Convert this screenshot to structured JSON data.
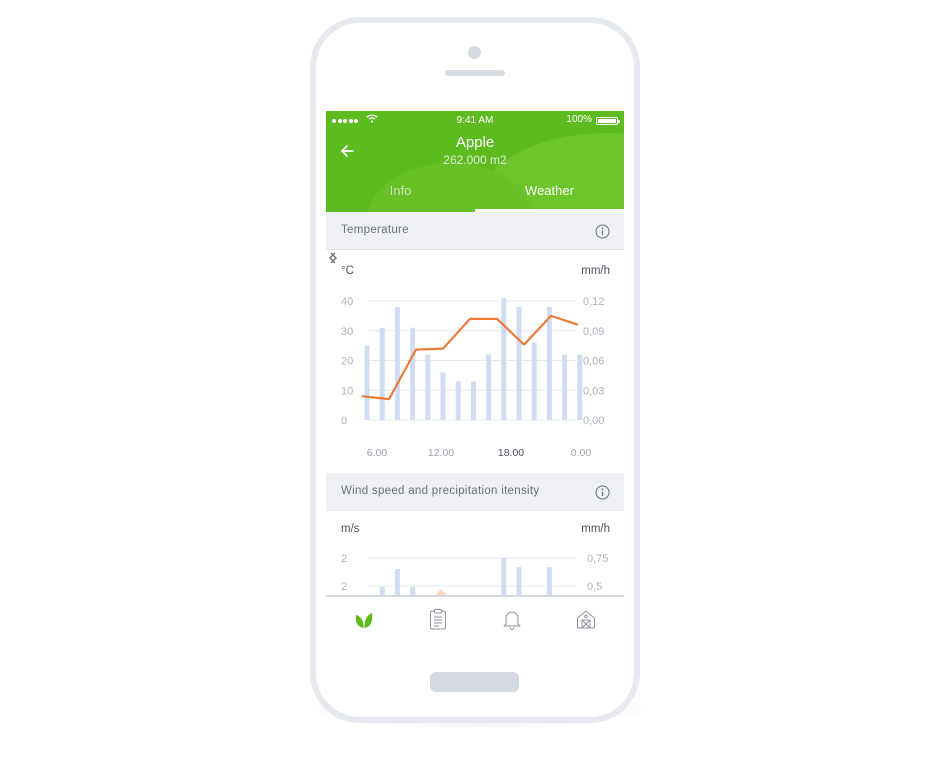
{
  "status_bar": {
    "time": "9:41 AM",
    "battery": "100%"
  },
  "header": {
    "title": "Apple",
    "subtitle": "262.000 m2"
  },
  "tabs": [
    {
      "label": "Info",
      "active": false
    },
    {
      "label": "Weather",
      "active": true
    }
  ],
  "temperature_section": {
    "title": "Temperature",
    "left_unit": "°C",
    "right_unit": "mm/h"
  },
  "wind_section": {
    "title": "Wind speed and precipitation itensity",
    "left_unit": "m/s",
    "right_unit": "mm/h"
  },
  "time_labels": [
    {
      "text": "6.00",
      "active": false
    },
    {
      "text": "12.00",
      "active": false
    },
    {
      "text": "18.00",
      "active": true
    },
    {
      "text": "0.00",
      "active": false
    }
  ],
  "colors": {
    "brand_green": "#5dbb1f",
    "bar_blue": "#d0dcf2",
    "line_orange": "#f07a3a"
  },
  "icons": [
    "back-arrow-icon",
    "wifi-icon",
    "battery-icon",
    "info-icon",
    "chevron-left-icon",
    "chevron-right-icon",
    "leaf-icon",
    "clipboard-icon",
    "bell-icon",
    "barn-icon"
  ],
  "chart_data": [
    {
      "type": "bar",
      "title": "Temperature",
      "left_axis": {
        "label": "°C",
        "ticks": [
          "40",
          "30",
          "20",
          "10",
          "0"
        ],
        "ylim": [
          0,
          40
        ]
      },
      "right_axis": {
        "label": "mm/h",
        "ticks": [
          "0,12",
          "0,09",
          "0,06",
          "0,03",
          "0,00"
        ],
        "ylim": [
          0,
          0.12
        ]
      },
      "x_tick_labels": [
        "6.00",
        "12.00",
        "18.00",
        "0.00"
      ],
      "grid": true,
      "series": [
        {
          "type": "bar",
          "axis": "left",
          "values": [
            25,
            31,
            38,
            31,
            22,
            16,
            13,
            13,
            22,
            41,
            38,
            26,
            38,
            22,
            22
          ]
        },
        {
          "type": "line",
          "axis": "right",
          "values": [
            0.024,
            0.021,
            0.071,
            0.072,
            0.102,
            0.102,
            0.076,
            0.105,
            0.096
          ]
        }
      ]
    },
    {
      "type": "bar",
      "title": "Wind speed and precipitation itensity",
      "left_axis": {
        "label": "m/s",
        "ticks": [
          "2",
          "2"
        ]
      },
      "right_axis": {
        "label": "mm/h",
        "ticks": [
          "0,75",
          "0,5"
        ]
      },
      "grid": true,
      "series": [
        {
          "type": "bar",
          "axis": "left",
          "values": [
            0,
            0.5,
            1.5,
            0.5,
            0,
            0,
            0,
            0,
            0,
            2.1,
            1.6,
            0,
            1.6,
            0,
            0
          ]
        }
      ]
    }
  ]
}
